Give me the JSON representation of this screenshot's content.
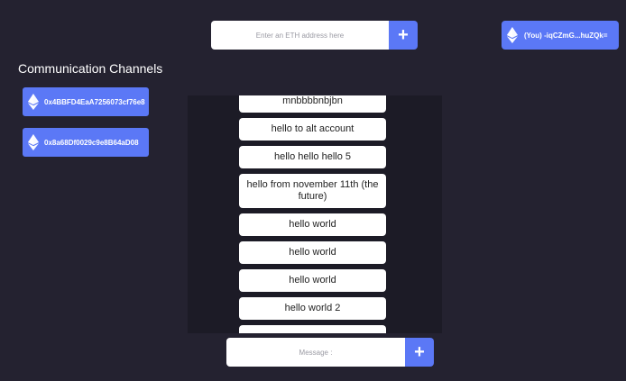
{
  "address_bar": {
    "placeholder": "Enter an ETH address here",
    "add_label": "+"
  },
  "account": {
    "label": "(You) -iqCZmG...huZQk="
  },
  "channels": {
    "title": "Communication Channels",
    "items": [
      {
        "address": "0x4BBFD4EaA7256073cf76e8",
        "icon": "ethereum-icon"
      },
      {
        "address": "0x8a68Df0029c9e8B64aD08",
        "icon": "ethereum-icon"
      }
    ]
  },
  "messages": [
    "mnbbbbnbjbn",
    "hello to alt account",
    "hello hello hello 5",
    "hello from november 11th (the future)",
    "hello world",
    "hello world",
    "hello world",
    "hello world 2"
  ],
  "message_bar": {
    "placeholder": "Message :",
    "send_label": "+"
  },
  "colors": {
    "background": "#242230",
    "panel": "#1c1b26",
    "accent": "#5b78f6"
  }
}
